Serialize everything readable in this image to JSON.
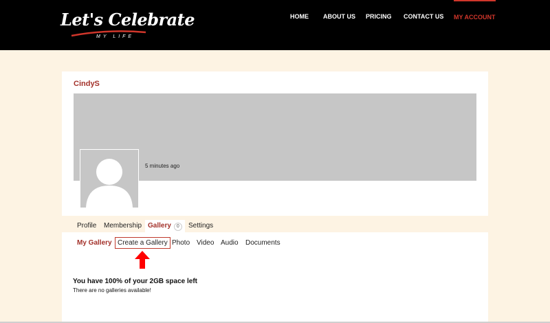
{
  "logo": {
    "main": "Let's Celebrate",
    "sub": "MY LIFE",
    "accent_color": "#d0362b"
  },
  "nav": {
    "items": [
      "HOME",
      "ABOUT US",
      "PRICING",
      "CONTACT US",
      "MY ACCOUNT"
    ],
    "active": "MY ACCOUNT"
  },
  "profile": {
    "username": "CindyS",
    "timestamp": "5 minutes ago",
    "avatar_icon": "user-silhouette-icon"
  },
  "tabs": {
    "profile": "Profile",
    "membership": "Membership",
    "gallery": "Gallery",
    "gallery_count": "0",
    "settings": "Settings",
    "active": "Gallery"
  },
  "subnav": {
    "my_gallery": "My Gallery",
    "create_gallery": "Create a Gallery",
    "photo": "Photo",
    "video": "Video",
    "audio": "Audio",
    "documents": "Documents",
    "active": "My Gallery"
  },
  "annotation": {
    "arrow_icon": "red-up-arrow-icon",
    "color": "#ff0000"
  },
  "storage": {
    "title": "You have 100% of your 2GB space left",
    "note": "There are no galleries available!"
  },
  "colors": {
    "header_bg": "#000000",
    "page_bg": "#fdf3e3",
    "brand_red": "#a3312a"
  }
}
